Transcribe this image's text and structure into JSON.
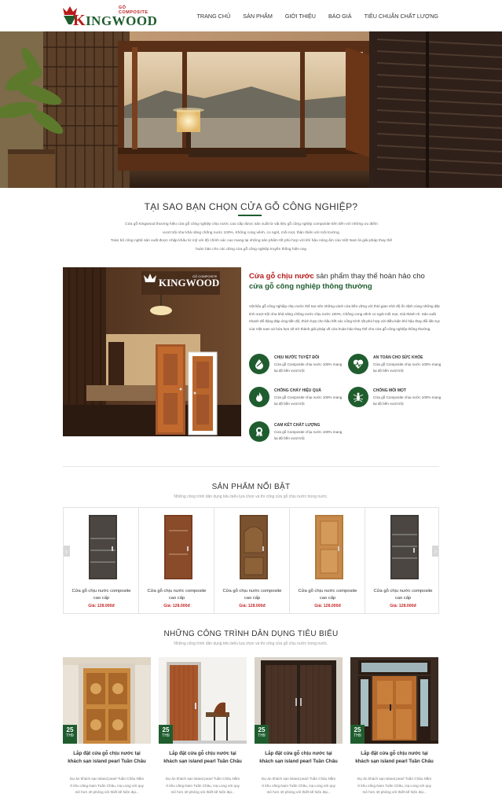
{
  "header": {
    "logo_brand_initial": "K",
    "logo_brand_rest": "INGWOOD",
    "logo_tagline": "GỖ COMPOSITE",
    "nav": [
      "TRANG CHỦ",
      "SẢN PHẨM",
      "GIỚI THIỆU",
      "BÁO GIÁ",
      "TIÊU CHUẨN CHẤT LƯỢNG"
    ]
  },
  "why": {
    "title": "TẠI SAO BẠN CHỌN CỬA GỖ CÔNG NGHIỆP?",
    "desc1": "Cửa gỗ Kingwood thương hiệu cửa gỗ công nghiệp chịu nước cao cấp được sản xuất từ vật liệu gỗ công nghệp composite tiên tiến với những ưu điểm",
    "desc2": "vượt trội như khả năng chống nước 100%, Không cong vênh, co ngót, mối mọt, thân thiện với môi trường.",
    "desc3": "Toàn bộ công nghệ sản xuất được nhập khẩu từ mỹ với độ chính xác cao mang lại những sản phẩm tốt phù hợp với khí hậu nóng ẩm của Việt Nam là giải pháp thay thế",
    "desc4": "hoàn hảo cho các dòng cửa gỗ công nghiệp truyền thống hiện nay."
  },
  "feature": {
    "image_logo": "KINGWOOD",
    "image_logo_tag": "GỖ COMPOSITE",
    "heading_red": "Cửa gỗ chịu nước",
    "heading_plain": " sản phẩm thay thế hoàn hảo cho",
    "heading_green": "cửa gỗ công nghiệp thông thường",
    "desc": "Vật liệu gỗ công nghiệp chịu nước thể tao nên những cánh cửa bền vững với thời gian nhờ độ ổn định cùng những đặc tính vượt trội như khả năng chống nước chịu nước 100%, Chống cong vênh co ngót mối mọt, Giá thành rẻ. Sản xuất nhanh để đáng đáp ứng tiến độ, thích hợp cho hầu hết các công trình rất phù hợp với điều kiện khí hậu thay đổi liên tục của Việt nam và hứa hẹn sẽ trở thành giải pháp về cửa hoàn hảo thay thế cho cửa gỗ công nghiệp thông thường.",
    "benefits": [
      {
        "title": "CHỊU NƯỚC TUYỆT ĐỐI",
        "desc": "Cửa gỗ Composite chịu nước 100% mang lại độ bền vượt trội",
        "icon": "water-drop-icon"
      },
      {
        "title": "AN TOÀN CHO SỨC KHỎE",
        "desc": "Cửa gỗ Composite chịu nước 100% mang lại độ bền vượt trội",
        "icon": "heartbeat-icon"
      },
      {
        "title": "CHỐNG CHÁY HIỆU QUẢ",
        "desc": "Cửa gỗ Composite chịu nước 100% mang lại độ bền vượt trội",
        "icon": "fire-icon"
      },
      {
        "title": "CHỐNG MỐI MỌT",
        "desc": "Cửa gỗ Composite chịu nước 100% mang lại độ bền vượt trội",
        "icon": "insect-icon"
      },
      {
        "title": "CAM KẾT CHẤT LƯỢNG",
        "desc": "Cửa gỗ Composite chịu nước 100% mang lại độ bền vượt trội",
        "icon": "badge-icon"
      }
    ]
  },
  "products": {
    "title": "SẢN PHẨM NỔI BẬT",
    "subtitle": "Những công trình dân dụng tiêu biểu lựa chọn và thi công cửa gỗ chịu nước trong nước.",
    "price_label": "Giá: ",
    "items": [
      {
        "name1": "Cửa gỗ chịu nước composite",
        "name2": "cao cấp",
        "price": "128.000đ",
        "color": "#3e3a36"
      },
      {
        "name1": "Cửa gỗ chịu nước composite",
        "name2": "cao cấp",
        "price": "128.000đ",
        "color": "#8a4b2a"
      },
      {
        "name1": "Cửa gỗ chịu nước composite",
        "name2": "cao cấp",
        "price": "128.000đ",
        "color": "#7a5230"
      },
      {
        "name1": "Cửa gỗ chịu nước composite",
        "name2": "cao cấp",
        "price": "128.000đ",
        "color": "#c88a4a"
      },
      {
        "name1": "Cửa gỗ chịu nước composite",
        "name2": "cao cấp",
        "price": "128.000đ",
        "color": "#3e3a36"
      }
    ],
    "prev_icon": "chevron-left-icon",
    "next_icon": "chevron-right-icon"
  },
  "projects": {
    "title": "NHỮNG CÔNG TRÌNH DÂN DỤNG TIÊU BIỂU",
    "subtitle": "Những công trình dân dụng tiêu biểu lựa chọn và thi công cửa gỗ chịu nước trong nước.",
    "items": [
      {
        "day": "25",
        "month": "TH9",
        "title": "Lắp đặt cửa gỗ chịu nước tại khách sạn island pearl Tuần Châu",
        "desc": "Dự án khách sạn island pearl Tuần Châu Nằm ở khu căng Nam Tuần Châu, Hạ Long với quy mô hơn 40 phòng với thiết kế hiện đại..."
      },
      {
        "day": "25",
        "month": "TH9",
        "title": "Lắp đặt cửa gỗ chịu nước tại khách sạn island pearl Tuần Châu",
        "desc": "Dự án khách sạn island pearl Tuần Châu Nằm ở khu căng Nam Tuần Châu, Hạ Long với quy mô hơn 40 phòng với thiết kế hiện đại..."
      },
      {
        "day": "25",
        "month": "TH9",
        "title": "Lắp đặt cửa gỗ chịu nước tại khách sạn island pearl Tuần Châu",
        "desc": "Dự án khách sạn island pearl Tuần Châu Nằm ở khu căng Nam Tuần Châu, Hạ Long với quy mô hơn 40 phòng với thiết kế hiện đại..."
      },
      {
        "day": "25",
        "month": "TH9",
        "title": "Lắp đặt cửa gỗ chịu nước tại khách sạn island pearl Tuần Châu",
        "desc": "Dự án khách sạn island pearl Tuần Châu Nằm ở khu căng Nam Tuần Châu, Hạ Long với quy mô hơn 40 phòng với thiết kế hiện đại..."
      }
    ]
  },
  "colors": {
    "brand_green": "#1f5d2e",
    "brand_red": "#b71c1c",
    "price_red": "#c62828"
  }
}
